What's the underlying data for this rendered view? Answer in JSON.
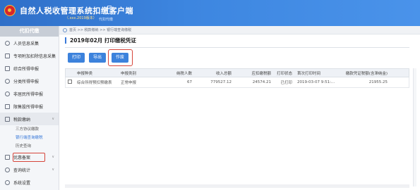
{
  "header": {
    "title": "自然人税收管理系统扣缴客户端",
    "subtitle": "（.xxx.2019版本）",
    "icon_label": "代扣代缴"
  },
  "sidebar": {
    "head": "代扣代缴",
    "items": [
      {
        "label": "人员信息采集",
        "icon": "person-icon"
      },
      {
        "label": "专项附加扣除信息采集",
        "icon": "list-icon",
        "chevron": "∨"
      },
      {
        "label": "综合所得申报",
        "icon": "form-icon"
      },
      {
        "label": "分类所得申报",
        "icon": "pie-icon"
      },
      {
        "label": "非居民所得申报",
        "icon": "globe-person-icon"
      },
      {
        "label": "限售股所得申报",
        "icon": "chart-icon"
      },
      {
        "label": "税款缴纳",
        "icon": "folder-icon",
        "chevron": "∨"
      }
    ],
    "subitems": [
      "三方协议缴款",
      "银行端查询缴税",
      "历史查询"
    ],
    "items_bottom": [
      {
        "label": "优惠备案",
        "icon": "doc-icon",
        "chevron": "∨"
      },
      {
        "label": "查询统计",
        "icon": "search-icon",
        "chevron": "∨"
      },
      {
        "label": "系统设置",
        "icon": "gear-icon"
      }
    ]
  },
  "breadcrumb": "首页 >> 税款缴纳 >> 银行端查询缴税",
  "page_title": "2019年02月  打印缴税凭证",
  "toolbar": {
    "print": "打印",
    "export": "导出",
    "void": "作废"
  },
  "table": {
    "headers": [
      "申报种类",
      "申报类别",
      "纳税人数",
      "收入总额",
      "应扣缴税额",
      "打印状态",
      "首次打印时间",
      "缴款凭证税额(含滞纳金)"
    ],
    "rows": [
      [
        "综合所得预扣预缴表",
        "正常申报",
        "67",
        "779527.12",
        "24574.21",
        "已打印",
        "2019-03-07 9:51:...",
        "21955.25"
      ]
    ]
  },
  "colors": {
    "header_bg": "#3d86e0",
    "button_bg": "#3c82dc",
    "highlight_border": "#d6453a"
  }
}
